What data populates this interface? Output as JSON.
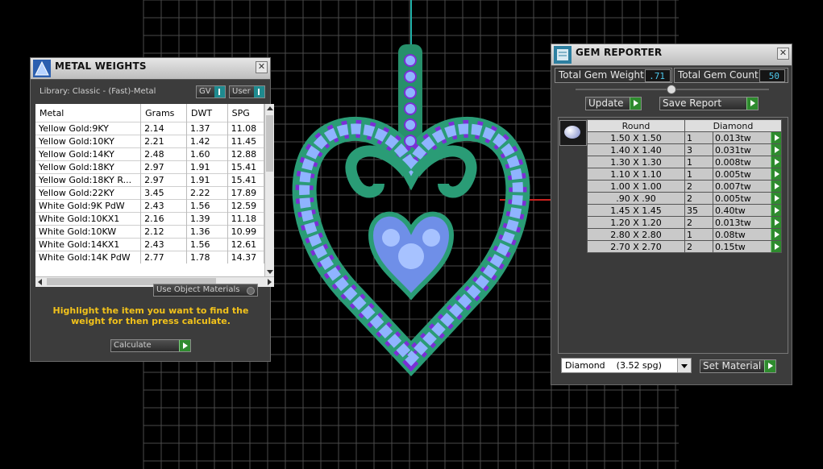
{
  "colors": {
    "grid": "#4c4c4c",
    "metal": "#2ea07a",
    "gem": "#8fb4ff",
    "accent_gem": "#7b2ed6",
    "panel": "#3c3c3c",
    "highlight_text": "#f2c21b",
    "value_text": "#4ec8ec"
  },
  "metal_weights": {
    "title": "METAL WEIGHTS",
    "close_glyph": "✕",
    "library": "Library: Classic - (Fast)-Metal",
    "gv_label": "GV",
    "user_label": "User",
    "columns": [
      "Metal",
      "Grams",
      "DWT",
      "SPG"
    ],
    "rows": [
      [
        "Yellow Gold:9KY",
        "2.14",
        "1.37",
        "11.08"
      ],
      [
        "Yellow Gold:10KY",
        "2.21",
        "1.42",
        "11.45"
      ],
      [
        "Yellow Gold:14KY",
        "2.48",
        "1.60",
        "12.88"
      ],
      [
        "Yellow Gold:18KY",
        "2.97",
        "1.91",
        "15.41"
      ],
      [
        "Yellow Gold:18KY R...",
        "2.97",
        "1.91",
        "15.41"
      ],
      [
        "Yellow Gold:22KY",
        "3.45",
        "2.22",
        "17.89"
      ],
      [
        "White Gold:9K PdW",
        "2.43",
        "1.56",
        "12.59"
      ],
      [
        "White Gold:10KX1",
        "2.16",
        "1.39",
        "11.18"
      ],
      [
        "White Gold:10KW",
        "2.12",
        "1.36",
        "10.99"
      ],
      [
        "White Gold:14KX1",
        "2.43",
        "1.56",
        "12.61"
      ],
      [
        "White Gold:14K PdW",
        "2.77",
        "1.78",
        "14.37"
      ]
    ],
    "use_object_materials": "Use Object Materials",
    "instruction": "Highlight the item you want to find the weight for then press calculate.",
    "calculate_label": "Calculate"
  },
  "gem_reporter": {
    "title": "GEM REPORTER",
    "close_glyph": "✕",
    "total_weight_label": "Total Gem Weight",
    "total_weight_value": ".71",
    "total_count_label": "Total Gem Count",
    "total_count_value": "50",
    "update_label": "Update",
    "save_report_label": "Save Report",
    "shape_header": "Round",
    "stone_header": "Diamond",
    "rows": [
      [
        "1.50 X 1.50",
        "1",
        "0.013tw"
      ],
      [
        "1.40 X 1.40",
        "3",
        "0.031tw"
      ],
      [
        "1.30 X 1.30",
        "1",
        "0.008tw"
      ],
      [
        "1.10 X 1.10",
        "1",
        "0.005tw"
      ],
      [
        "1.00 X 1.00",
        "2",
        "0.007tw"
      ],
      [
        ".90 X .90",
        "2",
        "0.005tw"
      ],
      [
        "1.45 X 1.45",
        "35",
        "0.40tw"
      ],
      [
        "1.20 X 1.20",
        "2",
        "0.013tw"
      ],
      [
        "2.80 X 2.80",
        "1",
        "0.08tw"
      ],
      [
        "2.70 X 2.70",
        "2",
        "0.15tw"
      ]
    ],
    "material_select": "Diamond    (3.52 spg)",
    "set_material_label": "Set Material"
  }
}
